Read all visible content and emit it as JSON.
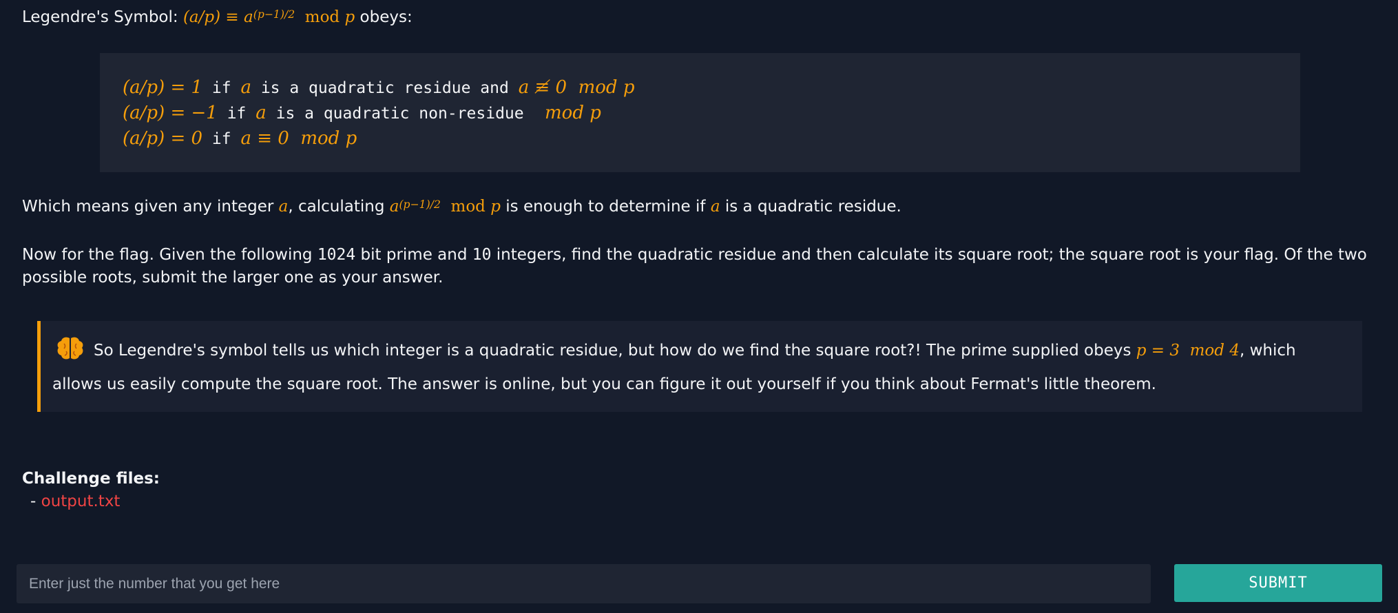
{
  "intro": {
    "lead": "Legendre's Symbol: ",
    "formula_lhs": "(a/p)",
    "equiv": " ≡ ",
    "base": "a",
    "exponent": "(p−1)/2",
    "mod": "  mod ",
    "modvar": "p",
    "tail": " obeys:"
  },
  "code_block": {
    "line1": {
      "m1": "(a/p) = 1",
      "t1": " if ",
      "m2": "a",
      "t2": " is a quadratic residue and ",
      "m3": "a ≢ 0",
      "m4": "  mod ",
      "m5": "p"
    },
    "line2": {
      "m1": "(a/p) = −1",
      "t1": " if ",
      "m2": "a",
      "t2": " is a quadratic non-residue ",
      "m4": "  mod ",
      "m5": "p"
    },
    "line3": {
      "m1": "(a/p) = 0",
      "t1": " if ",
      "m2": "a ≡ 0",
      "m4": "  mod ",
      "m5": "p"
    }
  },
  "paragraph1": {
    "t1": "Which means given any integer ",
    "m1": "a",
    "t2": ", calculating ",
    "m2": "a",
    "m2sup": "(p−1)/2",
    "m3": "  mod ",
    "m4": "p",
    "t3": " is enough to determine if ",
    "m5": "a",
    "t4": " is a quadratic residue."
  },
  "paragraph2": {
    "t1": "Now for the flag. Given the following ",
    "n1": "1024",
    "t2": " bit prime and ",
    "n2": "10",
    "t3": " integers, find the quadratic residue and then calculate its square root; the square root is your flag. Of the two possible roots, submit the larger one as your answer."
  },
  "callout": {
    "icon": "brain-icon",
    "t1": "So Legendre's symbol tells us which integer is a quadratic residue, but how do we find the square root?! The prime supplied obeys ",
    "m1": "p = 3",
    "m2": "  mod 4",
    "t2": ", which allows us easily compute the square root. The answer is online, but you can figure it out yourself if you think about Fermat's little theorem.",
    "border_color": "#f59e0b"
  },
  "files": {
    "title": "Challenge files:",
    "bullet": "- ",
    "items": [
      {
        "label": "output.txt"
      }
    ]
  },
  "answer": {
    "placeholder": "Enter just the number that you get here",
    "value": "",
    "submit_label": "SUBMIT"
  },
  "colors": {
    "background": "#111827",
    "math": "#f59e0b",
    "link": "#ef4444",
    "button": "#26a69a"
  }
}
